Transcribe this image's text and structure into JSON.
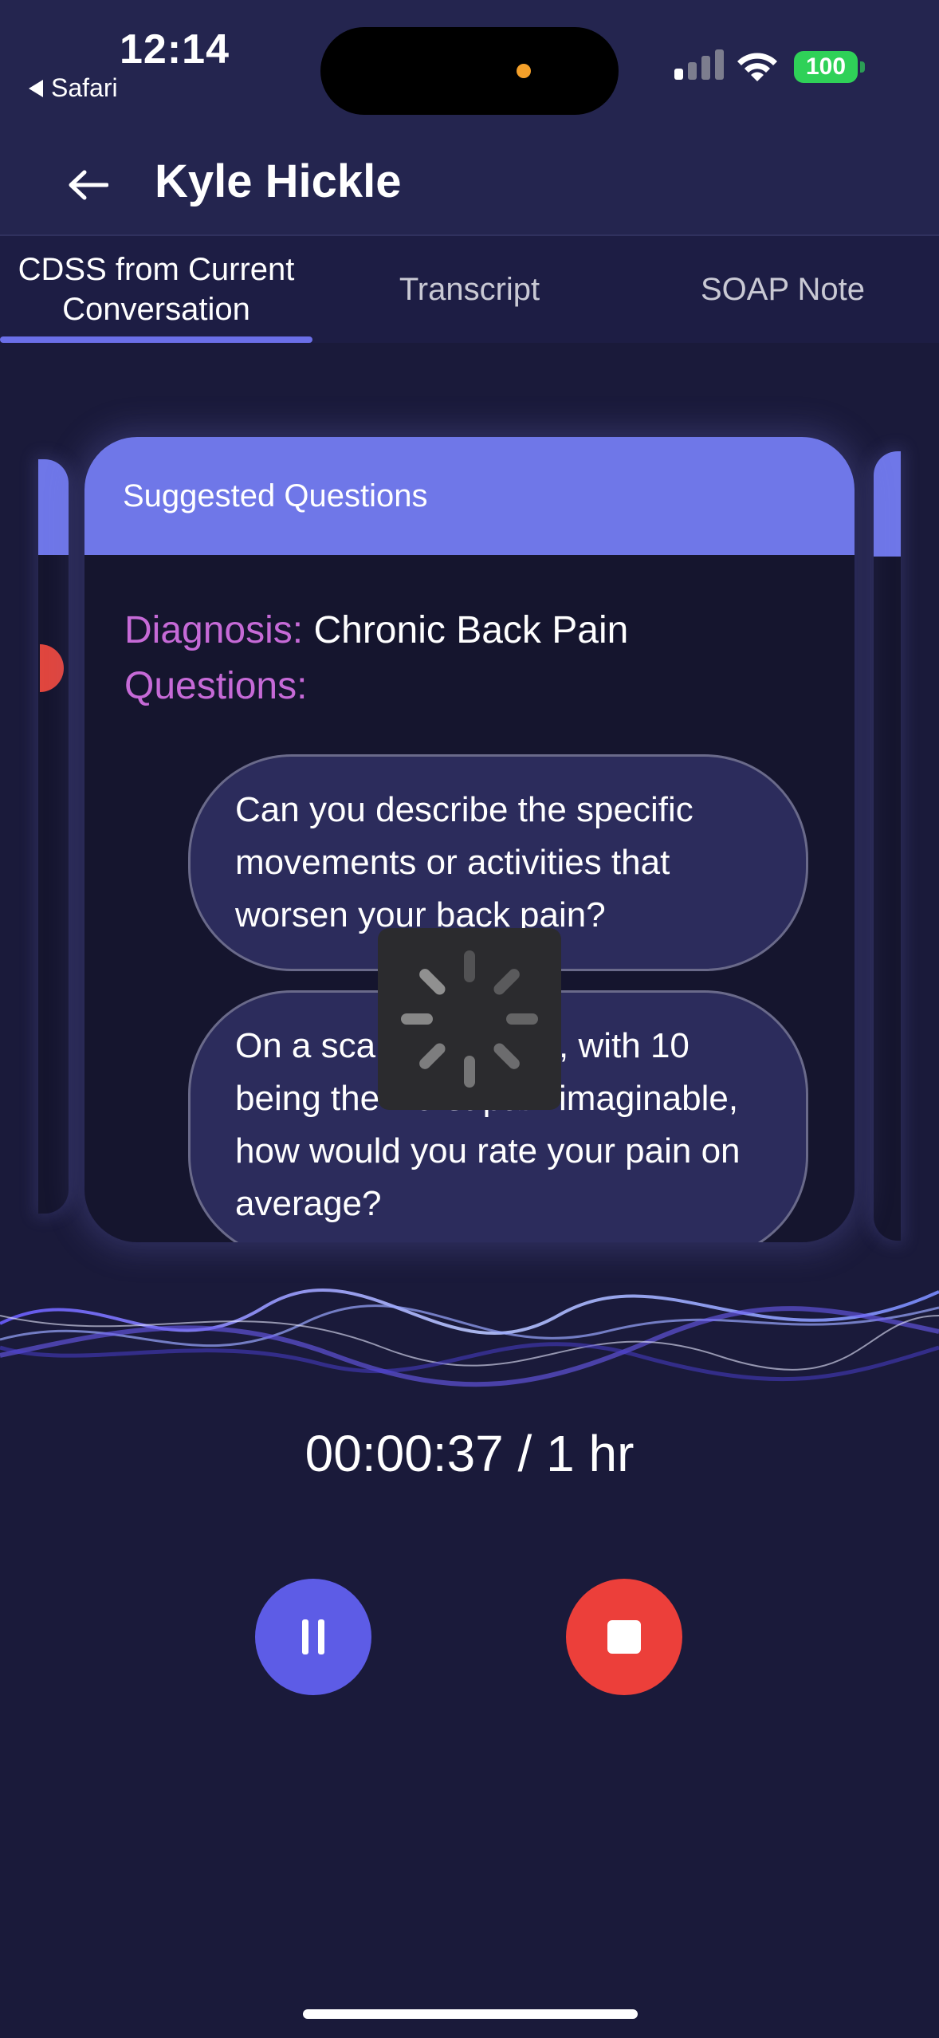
{
  "status_bar": {
    "time": "12:14",
    "back_app": "Safari",
    "battery": "100"
  },
  "header": {
    "title": "Kyle Hickle"
  },
  "tabs": [
    {
      "label": "CDSS from Current Conversation",
      "active": true
    },
    {
      "label": "Transcript",
      "active": false
    },
    {
      "label": "SOAP Note",
      "active": false
    }
  ],
  "card": {
    "header": "Suggested Questions",
    "diagnosis_label": "Diagnosis:",
    "diagnosis_value": "Chronic Back Pain",
    "questions_label": "Questions:",
    "questions": [
      "Can you describe the specific movements or activities that worsen your back pain?",
      "On a scale of 1 to 10, with 10 being the worst pain imaginable, how would you rate your pain on average?"
    ]
  },
  "recording": {
    "timer": "00:00:37 / 1 hr"
  },
  "colors": {
    "background": "#1a1a3a",
    "accent": "#6f77e8",
    "label": "#c66ad7",
    "stop": "#ec3f3a",
    "pause": "#5d5ce6"
  },
  "icons": [
    "back-arrow-icon",
    "pause-icon",
    "stop-icon",
    "wifi-icon",
    "signal-icon",
    "battery-icon",
    "loading-spinner-icon"
  ]
}
